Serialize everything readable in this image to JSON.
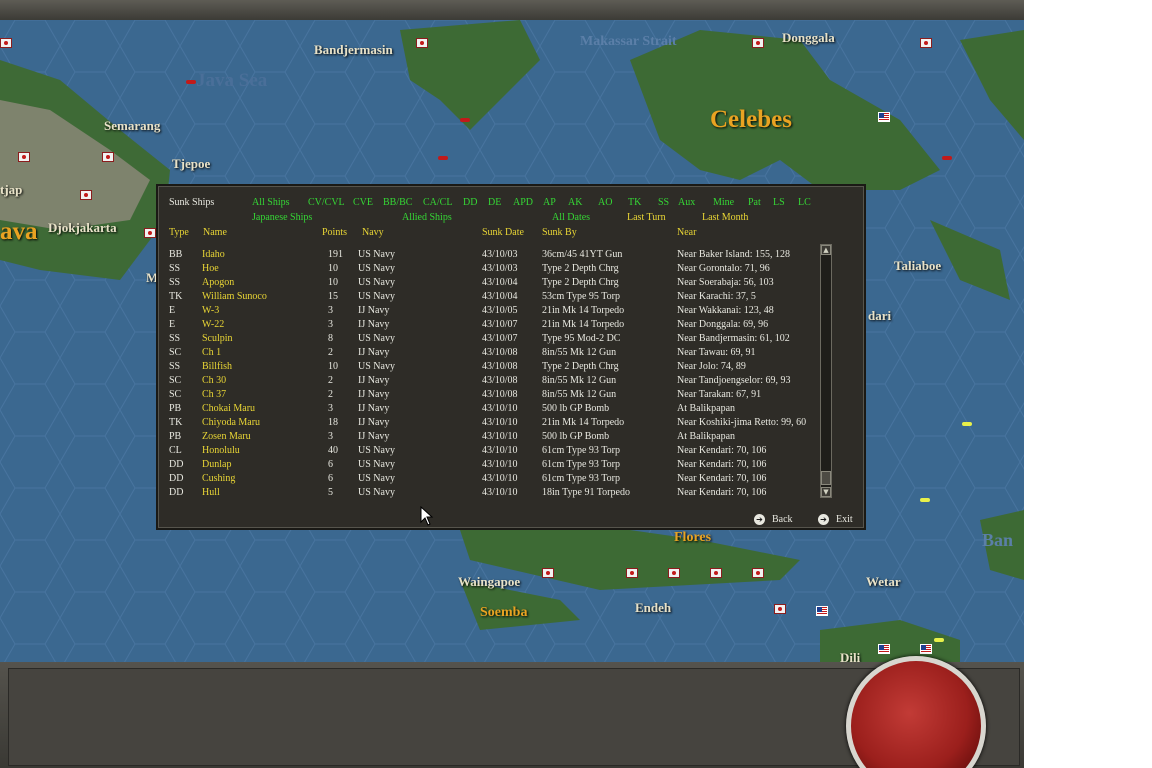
{
  "map": {
    "labels": {
      "banjermasin": "Bandjermasin",
      "makassar": "Makassar Strait",
      "donggala": "Donggala",
      "java_sea": "Java Sea",
      "semarang": "Semarang",
      "tjepoe": "Tjepoe",
      "celebes": "Celebes",
      "tjap": "tjap",
      "djokjakarta": "Djokjakarta",
      "ava": "ava",
      "m": "M",
      "taliaboe": "Taliaboe",
      "dari": "dari",
      "flores": "Flores",
      "waingapoe": "Waingapoe",
      "soemba": "Soemba",
      "endeh": "Endeh",
      "wetar": "Wetar",
      "dili": "Dili",
      "ban": "Ban"
    }
  },
  "panel": {
    "title": "Sunk Ships",
    "type_filters": [
      "All Ships",
      "CV/CVL",
      "CVE",
      "BB/BC",
      "CA/CL",
      "DD",
      "DE",
      "APD",
      "AP",
      "AK",
      "AO",
      "TK",
      "SS",
      "Aux",
      "Mine",
      "Pat",
      "LS",
      "LC"
    ],
    "navy_filters": [
      "Japanese Ships",
      "Allied Ships"
    ],
    "date_filters": [
      "All Dates",
      "Last Turn",
      "Last Month"
    ],
    "columns": {
      "type": "Type",
      "name": "Name",
      "points": "Points",
      "navy": "Navy",
      "sunk_date": "Sunk Date",
      "sunk_by": "Sunk By",
      "near": "Near"
    },
    "rows": [
      {
        "type": "BB",
        "name": "Idaho",
        "points": "191",
        "navy": "US Navy",
        "date": "43/10/03",
        "by": "36cm/45 41YT Gun",
        "near": "Near Baker Island: 155, 128"
      },
      {
        "type": "SS",
        "name": "Hoe",
        "points": "10",
        "navy": "US Navy",
        "date": "43/10/03",
        "by": "Type 2 Depth Chrg",
        "near": "Near Gorontalo: 71, 96"
      },
      {
        "type": "SS",
        "name": "Apogon",
        "points": "10",
        "navy": "US Navy",
        "date": "43/10/04",
        "by": "Type 2 Depth Chrg",
        "near": "Near Soerabaja: 56, 103"
      },
      {
        "type": "TK",
        "name": "William Sunoco",
        "points": "15",
        "navy": "US Navy",
        "date": "43/10/04",
        "by": "53cm Type 95 Torp",
        "near": "Near Karachi: 37, 5"
      },
      {
        "type": "E",
        "name": "W-3",
        "points": "3",
        "navy": "IJ Navy",
        "date": "43/10/05",
        "by": "21in Mk 14 Torpedo",
        "near": "Near Wakkanai: 123, 48"
      },
      {
        "type": "E",
        "name": "W-22",
        "points": "3",
        "navy": "IJ Navy",
        "date": "43/10/07",
        "by": "21in Mk 14 Torpedo",
        "near": "Near Donggala: 69, 96"
      },
      {
        "type": "SS",
        "name": "Sculpin",
        "points": "8",
        "navy": "US Navy",
        "date": "43/10/07",
        "by": "Type 95 Mod-2 DC",
        "near": "Near Bandjermasin: 61, 102"
      },
      {
        "type": "SC",
        "name": "Ch 1",
        "points": "2",
        "navy": "IJ Navy",
        "date": "43/10/08",
        "by": "8in/55 Mk 12 Gun",
        "near": "Near Tawau: 69, 91"
      },
      {
        "type": "SS",
        "name": "Billfish",
        "points": "10",
        "navy": "US Navy",
        "date": "43/10/08",
        "by": "Type 2 Depth Chrg",
        "near": "Near Jolo: 74, 89"
      },
      {
        "type": "SC",
        "name": "Ch 30",
        "points": "2",
        "navy": "IJ Navy",
        "date": "43/10/08",
        "by": "8in/55 Mk 12 Gun",
        "near": "Near Tandjoengselor: 69, 93"
      },
      {
        "type": "SC",
        "name": "Ch 37",
        "points": "2",
        "navy": "IJ Navy",
        "date": "43/10/08",
        "by": "8in/55 Mk 12 Gun",
        "near": "Near Tarakan: 67, 91"
      },
      {
        "type": "PB",
        "name": "Chokai Maru",
        "points": "3",
        "navy": "IJ Navy",
        "date": "43/10/10",
        "by": "500 lb GP Bomb",
        "near": "At Balikpapan"
      },
      {
        "type": "TK",
        "name": "Chiyoda Maru",
        "points": "18",
        "navy": "IJ Navy",
        "date": "43/10/10",
        "by": "21in Mk 14 Torpedo",
        "near": "Near Koshiki-jima Retto: 99, 60"
      },
      {
        "type": "PB",
        "name": "Zosen Maru",
        "points": "3",
        "navy": "IJ Navy",
        "date": "43/10/10",
        "by": "500 lb GP Bomb",
        "near": "At Balikpapan"
      },
      {
        "type": "CL",
        "name": "Honolulu",
        "points": "40",
        "navy": "US Navy",
        "date": "43/10/10",
        "by": "61cm Type 93 Torp",
        "near": "Near Kendari: 70, 106"
      },
      {
        "type": "DD",
        "name": "Dunlap",
        "points": "6",
        "navy": "US Navy",
        "date": "43/10/10",
        "by": "61cm Type 93 Torp",
        "near": "Near Kendari: 70, 106"
      },
      {
        "type": "DD",
        "name": "Cushing",
        "points": "6",
        "navy": "US Navy",
        "date": "43/10/10",
        "by": "61cm Type 93 Torp",
        "near": "Near Kendari: 70, 106"
      },
      {
        "type": "DD",
        "name": "Hull",
        "points": "5",
        "navy": "US Navy",
        "date": "43/10/10",
        "by": "18in Type 91 Torpedo",
        "near": "Near Kendari: 70, 106"
      }
    ],
    "buttons": {
      "back": "Back",
      "exit": "Exit"
    }
  },
  "colors": {
    "header": "#e8d535",
    "filter": "#35d635",
    "text": "#e8e8e0",
    "panel": "#2e2c27"
  },
  "icons": [
    "scroll-up-arrow-icon",
    "scroll-down-arrow-icon",
    "back-arrow-icon",
    "exit-arrow-icon",
    "mouse-pointer-icon"
  ]
}
